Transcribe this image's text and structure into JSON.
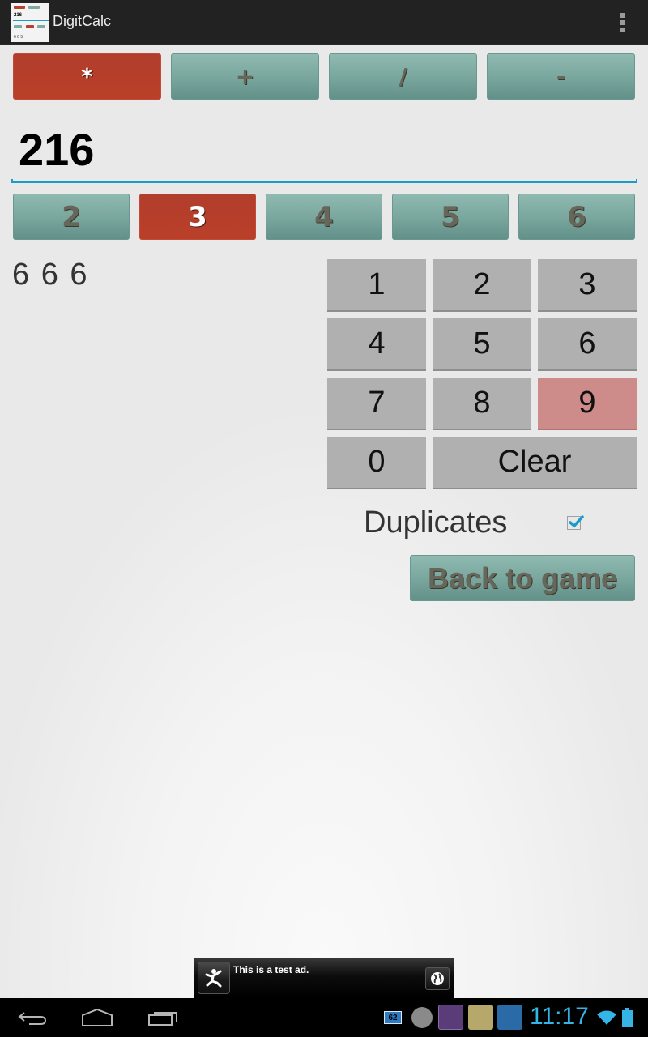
{
  "app": {
    "title": "DigitCalc",
    "icon": "digitcalc-app-icon",
    "icon_preview": {
      "target": "216",
      "result": "6 6 5"
    },
    "overflow_menu_icon": "overflow-menu-icon"
  },
  "operators": [
    {
      "label": "*",
      "selected": true
    },
    {
      "label": "+",
      "selected": false
    },
    {
      "label": "/",
      "selected": false
    },
    {
      "label": "-",
      "selected": false
    }
  ],
  "target_value": "216",
  "digit_counts": [
    {
      "label": "2",
      "selected": false
    },
    {
      "label": "3",
      "selected": true
    },
    {
      "label": "4",
      "selected": false
    },
    {
      "label": "5",
      "selected": false
    },
    {
      "label": "6",
      "selected": false
    }
  ],
  "result_text": "6 6 6",
  "keypad": {
    "keys": [
      "1",
      "2",
      "3",
      "4",
      "5",
      "6",
      "7",
      "8",
      "9",
      "0"
    ],
    "highlighted_key": "9",
    "clear_label": "Clear"
  },
  "duplicates": {
    "label": "Duplicates",
    "checked": true
  },
  "back_button_label": "Back to game",
  "ad": {
    "text": "This is a test ad.",
    "icon": "running-man-icon",
    "action_icon": "globe-icon"
  },
  "system_bar": {
    "nav": [
      "back-icon",
      "home-icon",
      "recent-apps-icon"
    ],
    "notifications": [
      {
        "icon": "battery-level-notification-icon",
        "text": "62"
      },
      {
        "icon": "torrent-app-icon"
      },
      {
        "icon": "viber-app-icon"
      },
      {
        "icon": "app-notification-icon"
      },
      {
        "icon": "app-grid-notification-icon"
      }
    ],
    "clock": "11:17",
    "wifi_icon": "wifi-icon",
    "battery_icon": "battery-icon"
  },
  "colors": {
    "selected": "#b83f2a",
    "unselected": "#7fa9a1",
    "accent": "#1b9bc7",
    "key": "#b0b0b0",
    "key_highlight": "#cd8b8a",
    "clock": "#34b5e5"
  }
}
